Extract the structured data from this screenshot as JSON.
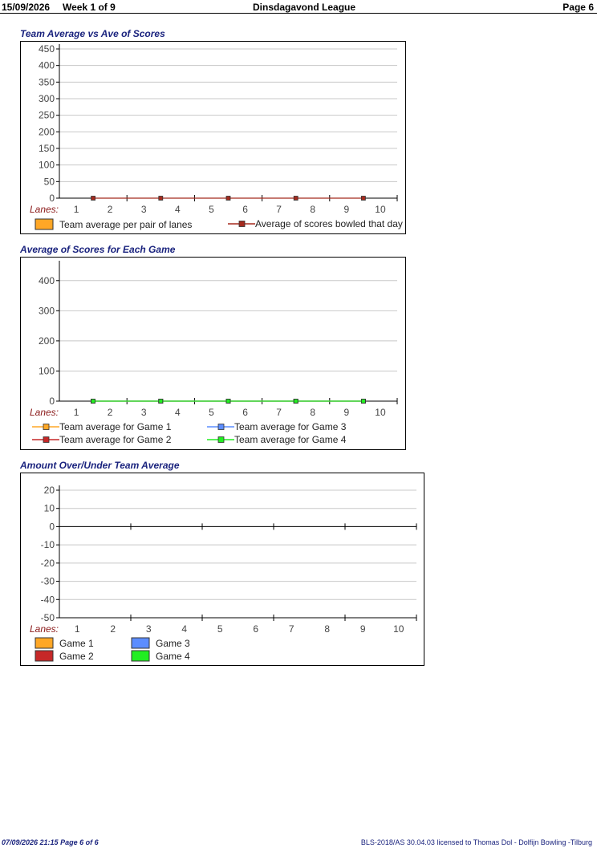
{
  "header": {
    "date": "15/09/2026",
    "week": "Week 1 of 9",
    "league": "Dinsdagavond League",
    "page": "Page 6"
  },
  "footer": {
    "printed": "07/09/2026  21:15  Page 6 of 6",
    "license": "BLS-2018/AS 30.04.03 licensed to Thomas Dol - Dolfijn Bowling -Tilburg"
  },
  "colors": {
    "game1": "#ffa726",
    "game2": "#c62828",
    "game3": "#5c8dff",
    "game4": "#22ee22",
    "title": "#1a237e",
    "grid": "#c8c8c8"
  },
  "chart_data": [
    {
      "type": "bar",
      "title": "Team Average vs Ave of Scores",
      "xlabel": "Lanes:",
      "categories": [
        "1",
        "2",
        "3",
        "4",
        "5",
        "6",
        "7",
        "8",
        "9",
        "10"
      ],
      "ylim": [
        0,
        450
      ],
      "yticks": [
        0,
        50,
        100,
        150,
        200,
        250,
        300,
        350,
        400,
        450
      ],
      "grid": true,
      "legend_position": "bottom",
      "series": [
        {
          "name": "Team average per pair of lanes",
          "kind": "bar",
          "color": "#ffa726",
          "values": [
            0,
            0,
            0,
            0,
            0
          ]
        },
        {
          "name": "Average of scores bowled that day",
          "kind": "line",
          "color": "#a52a1e",
          "values": [
            0,
            0,
            0,
            0,
            0
          ]
        }
      ]
    },
    {
      "type": "line",
      "title": "Average of Scores for Each Game",
      "xlabel": "Lanes:",
      "categories": [
        "1",
        "2",
        "3",
        "4",
        "5",
        "6",
        "7",
        "8",
        "9",
        "10"
      ],
      "ylim": [
        0,
        450
      ],
      "yticks": [
        0,
        100,
        200,
        300,
        400
      ],
      "grid": true,
      "legend_position": "bottom",
      "series": [
        {
          "name": "Team average for Game 1",
          "color": "#ffa726",
          "values": [
            0,
            0,
            0,
            0,
            0
          ]
        },
        {
          "name": "Team average for Game 2",
          "color": "#c62828",
          "values": [
            0,
            0,
            0,
            0,
            0
          ]
        },
        {
          "name": "Team average for Game 3",
          "color": "#5c8dff",
          "values": [
            0,
            0,
            0,
            0,
            0
          ]
        },
        {
          "name": "Team average for Game 4",
          "color": "#22ee22",
          "values": [
            0,
            0,
            0,
            0,
            0
          ]
        }
      ]
    },
    {
      "type": "bar",
      "title": "Amount Over/Under Team Average",
      "xlabel": "Lanes:",
      "categories": [
        "1",
        "2",
        "3",
        "4",
        "5",
        "6",
        "7",
        "8",
        "9",
        "10"
      ],
      "ylim": [
        -50,
        20
      ],
      "yticks": [
        -50,
        -40,
        -30,
        -20,
        -10,
        0,
        10,
        20
      ],
      "grid": true,
      "legend_position": "bottom",
      "series": [
        {
          "name": "Game 1",
          "color": "#ffa726",
          "values": [
            0,
            0,
            0,
            0,
            0
          ]
        },
        {
          "name": "Game 2",
          "color": "#c62828",
          "values": [
            0,
            0,
            0,
            0,
            0
          ]
        },
        {
          "name": "Game 3",
          "color": "#5c8dff",
          "values": [
            0,
            0,
            0,
            0,
            0
          ]
        },
        {
          "name": "Game 4",
          "color": "#22ee22",
          "values": [
            0,
            0,
            0,
            0,
            0
          ]
        }
      ]
    }
  ]
}
